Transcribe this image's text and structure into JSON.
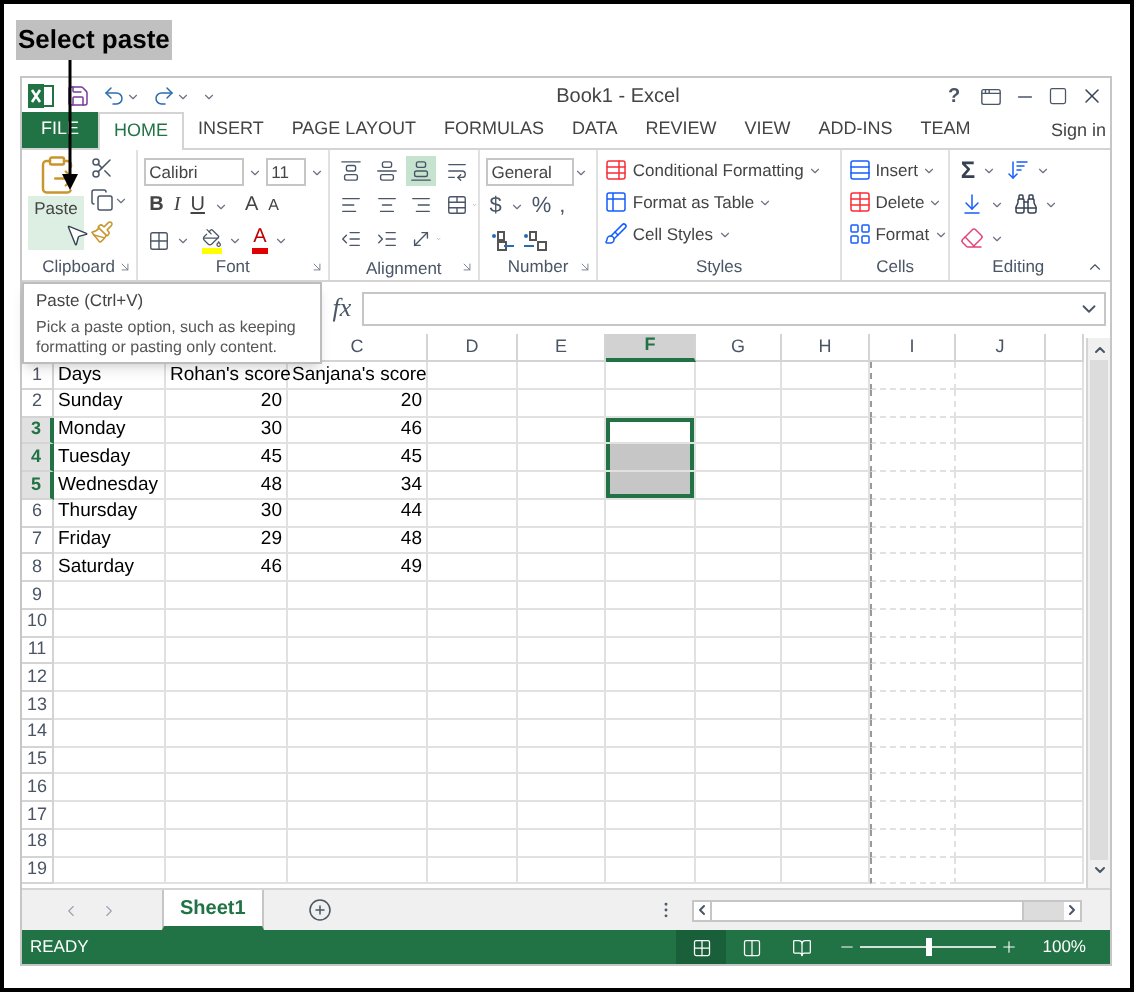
{
  "callout": {
    "label": "Select paste"
  },
  "window": {
    "title": "Book1 - Excel",
    "help": "?"
  },
  "tabs": [
    {
      "label": "FILE",
      "kind": "file",
      "selected": false
    },
    {
      "label": "HOME",
      "kind": "tab",
      "selected": true
    },
    {
      "label": "INSERT",
      "kind": "tab",
      "selected": false
    },
    {
      "label": "PAGE LAYOUT",
      "kind": "tab",
      "selected": false
    },
    {
      "label": "FORMULAS",
      "kind": "tab",
      "selected": false
    },
    {
      "label": "DATA",
      "kind": "tab",
      "selected": false
    },
    {
      "label": "REVIEW",
      "kind": "tab",
      "selected": false
    },
    {
      "label": "VIEW",
      "kind": "tab",
      "selected": false
    },
    {
      "label": "ADD-INS",
      "kind": "tab",
      "selected": false
    },
    {
      "label": "TEAM",
      "kind": "tab",
      "selected": false
    }
  ],
  "account": {
    "label": "Sign in"
  },
  "clipboard": {
    "paste": "Paste",
    "group": "Clipboard"
  },
  "font": {
    "name": "Calibri",
    "size": "11",
    "styles": [
      "B",
      "I",
      "U"
    ],
    "grow": "A",
    "shrink": "A",
    "color_letter": "A",
    "group": "Font"
  },
  "alignment": {
    "group": "Alignment",
    "buttons": [
      {
        "kind": "top",
        "selected": false
      },
      {
        "kind": "middle",
        "selected": false
      },
      {
        "kind": "bottom",
        "selected": true
      },
      {
        "kind": "wrap",
        "selected": false
      },
      {
        "kind": "left",
        "selected": false
      },
      {
        "kind": "center",
        "selected": false
      },
      {
        "kind": "right",
        "selected": false
      },
      {
        "kind": "merge",
        "selected": false
      },
      {
        "kind": "outdent",
        "selected": false
      },
      {
        "kind": "indent",
        "selected": false
      },
      {
        "kind": "orientation",
        "selected": false
      }
    ]
  },
  "number": {
    "format": "General",
    "symbols": [
      "$",
      "%",
      ","
    ],
    "group": "Number"
  },
  "styles": {
    "items": [
      "Conditional Formatting",
      "Format as Table",
      "Cell Styles"
    ],
    "group": "Styles"
  },
  "cells": {
    "items": [
      "Insert",
      "Delete",
      "Format"
    ],
    "group": "Cells"
  },
  "editing": {
    "sum": "Σ",
    "group": "Editing"
  },
  "tooltip": {
    "title": "Paste (Ctrl+V)",
    "text": "Pick a paste option, such as keeping formatting or pasting only content."
  },
  "formula_bar": {
    "fx": "fx"
  },
  "columns": [
    {
      "label": "C",
      "selected": false
    },
    {
      "label": "D",
      "selected": false
    },
    {
      "label": "E",
      "selected": false
    },
    {
      "label": "F",
      "selected": true
    },
    {
      "label": "G",
      "selected": false
    },
    {
      "label": "H",
      "selected": false
    },
    {
      "label": "I",
      "selected": false
    },
    {
      "label": "J",
      "selected": false
    }
  ],
  "rows": [
    {
      "number": "1",
      "selected": false,
      "kind": "header",
      "cells": [
        "Days",
        "Rohan's score",
        "Sanjana's score"
      ]
    },
    {
      "number": "2",
      "selected": false,
      "kind": "data",
      "cells": [
        "Sunday",
        "20",
        "20"
      ]
    },
    {
      "number": "3",
      "selected": true,
      "kind": "data",
      "cells": [
        "Monday",
        "30",
        "46"
      ]
    },
    {
      "number": "4",
      "selected": true,
      "kind": "data",
      "cells": [
        "Tuesday",
        "45",
        "45"
      ]
    },
    {
      "number": "5",
      "selected": true,
      "kind": "data",
      "cells": [
        "Wednesday",
        "48",
        "34"
      ]
    },
    {
      "number": "6",
      "selected": false,
      "kind": "data",
      "cells": [
        "Thursday",
        "30",
        "44"
      ]
    },
    {
      "number": "7",
      "selected": false,
      "kind": "data",
      "cells": [
        "Friday",
        "29",
        "48"
      ]
    },
    {
      "number": "8",
      "selected": false,
      "kind": "data",
      "cells": [
        "Saturday",
        "46",
        "49"
      ]
    },
    {
      "number": "9",
      "selected": false
    },
    {
      "number": "10",
      "selected": false
    },
    {
      "number": "11",
      "selected": false
    },
    {
      "number": "12",
      "selected": false
    },
    {
      "number": "13",
      "selected": false
    },
    {
      "number": "14",
      "selected": false
    },
    {
      "number": "15",
      "selected": false
    },
    {
      "number": "16",
      "selected": false
    },
    {
      "number": "17",
      "selected": false
    },
    {
      "number": "18",
      "selected": false
    },
    {
      "number": "19",
      "selected": false
    }
  ],
  "sheet_tabs": [
    {
      "label": "Sheet1",
      "selected": true
    }
  ],
  "status_bar": {
    "text": "READY",
    "zoom": "100%",
    "zoom_slider": {
      "level": 0.5
    },
    "views": [
      {
        "kind": "normal",
        "selected": true
      },
      {
        "kind": "page_layout",
        "selected": false
      },
      {
        "kind": "page_break",
        "selected": false
      }
    ]
  }
}
